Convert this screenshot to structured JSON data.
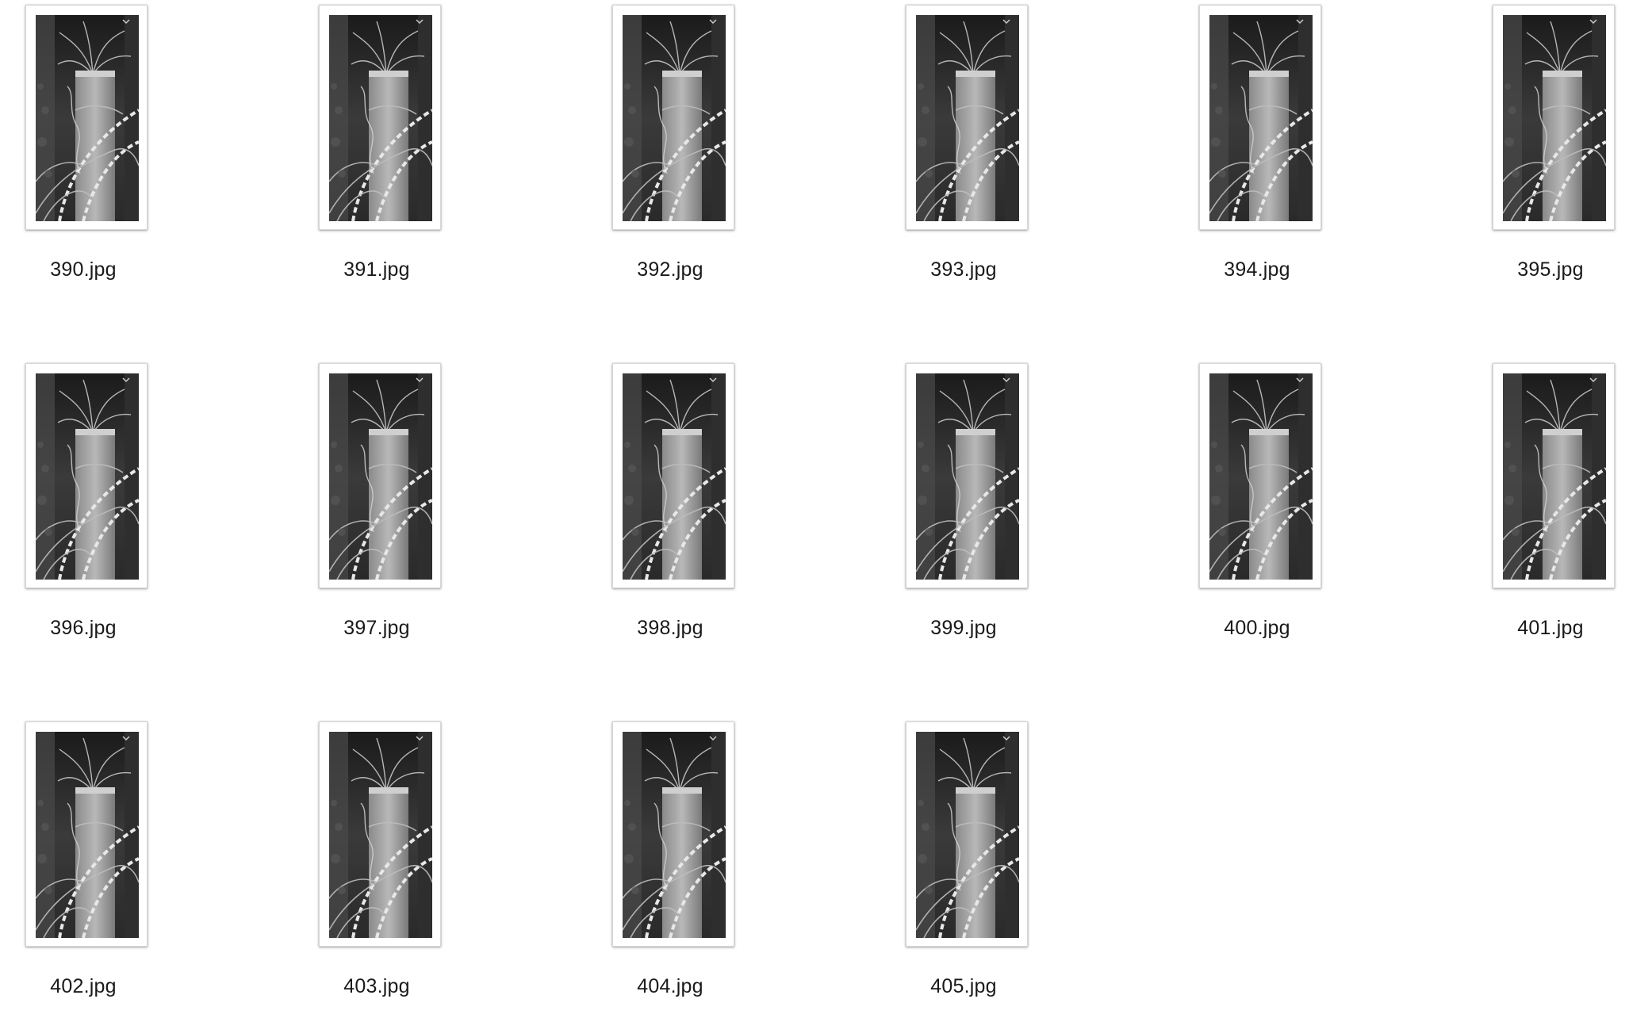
{
  "files": [
    {
      "name": "390.jpg"
    },
    {
      "name": "391.jpg"
    },
    {
      "name": "392.jpg"
    },
    {
      "name": "393.jpg"
    },
    {
      "name": "394.jpg"
    },
    {
      "name": "395.jpg"
    },
    {
      "name": "396.jpg"
    },
    {
      "name": "397.jpg"
    },
    {
      "name": "398.jpg"
    },
    {
      "name": "399.jpg"
    },
    {
      "name": "400.jpg"
    },
    {
      "name": "401.jpg"
    },
    {
      "name": "402.jpg"
    },
    {
      "name": "403.jpg"
    },
    {
      "name": "404.jpg"
    },
    {
      "name": "405.jpg"
    }
  ]
}
